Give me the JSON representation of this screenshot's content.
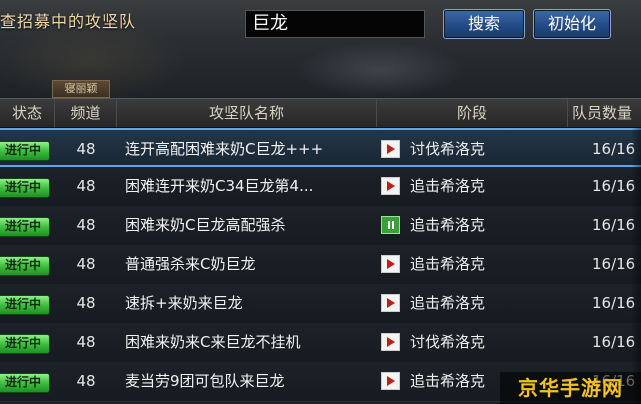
{
  "header": {
    "recruit_title": "查招募中的攻坚队",
    "search_value": "巨龙",
    "search_button": "搜索",
    "reset_button": "初始化",
    "sub_tab": "寝丽颖"
  },
  "columns": {
    "status": "状态",
    "channel": "频道",
    "name": "攻坚队名称",
    "stage": "阶段",
    "count": "队员数量"
  },
  "rows": [
    {
      "status": "进行中",
      "channel": "48",
      "name": "连开高配困难来奶C巨龙+++",
      "stage_icon": "play-icon",
      "stage": "讨伐希洛克",
      "count": "16/16"
    },
    {
      "status": "进行中",
      "channel": "48",
      "name": "困难连开来奶C34巨龙第4...",
      "stage_icon": "play-icon",
      "stage": "追击希洛克",
      "count": "16/16"
    },
    {
      "status": "进行中",
      "channel": "48",
      "name": "困难来奶C巨龙高配强杀",
      "stage_icon": "pause-icon",
      "stage": "追击希洛克",
      "count": "16/16"
    },
    {
      "status": "进行中",
      "channel": "48",
      "name": "普通强杀来C奶巨龙",
      "stage_icon": "play-icon",
      "stage": "追击希洛克",
      "count": "16/16"
    },
    {
      "status": "进行中",
      "channel": "48",
      "name": "速拆+来奶来巨龙",
      "stage_icon": "play-icon",
      "stage": "追击希洛克",
      "count": "16/16"
    },
    {
      "status": "进行中",
      "channel": "48",
      "name": "困难来奶来C来巨龙不挂机",
      "stage_icon": "play-icon",
      "stage": "讨伐希洛克",
      "count": "16/16"
    },
    {
      "status": "进行中",
      "channel": "48",
      "name": "麦当劳9团可包队来巨龙",
      "stage_icon": "play-icon",
      "stage": "追击希洛克",
      "count": "16/16"
    }
  ],
  "watermark": "京华手游网",
  "colors": {
    "accent_blue": "#234b86",
    "status_green": "#3fbf3f",
    "selected_border": "#5fa6e8",
    "watermark_gold": "#f5c21e"
  }
}
